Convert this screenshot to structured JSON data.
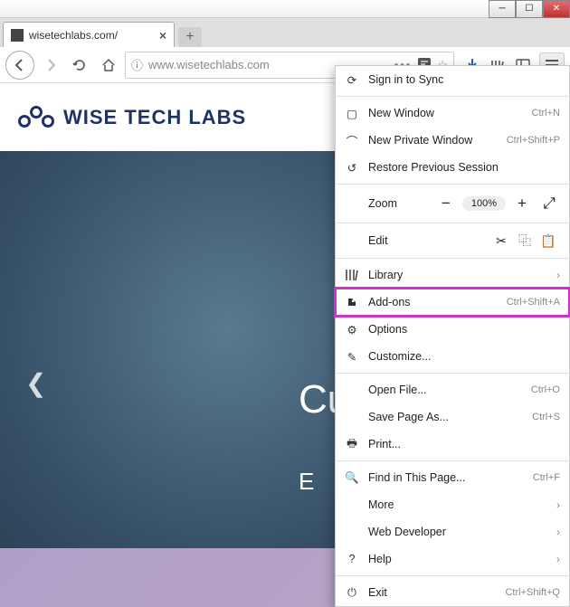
{
  "window": {
    "tab_title": "wisetechlabs.com/",
    "url_display": "www.wisetechlabs.com"
  },
  "page": {
    "logo_text": "WISE TECH LABS",
    "hero_line1": "Cu",
    "hero_line2": "E"
  },
  "menu": {
    "sign_in": "Sign in to Sync",
    "new_window": {
      "label": "New Window",
      "shortcut": "Ctrl+N"
    },
    "new_private": {
      "label": "New Private Window",
      "shortcut": "Ctrl+Shift+P"
    },
    "restore": "Restore Previous Session",
    "zoom": {
      "label": "Zoom",
      "value": "100%"
    },
    "edit": {
      "label": "Edit"
    },
    "library": "Library",
    "addons": {
      "label": "Add-ons",
      "shortcut": "Ctrl+Shift+A"
    },
    "options": "Options",
    "customize": "Customize...",
    "open_file": {
      "label": "Open File...",
      "shortcut": "Ctrl+O"
    },
    "save_as": {
      "label": "Save Page As...",
      "shortcut": "Ctrl+S"
    },
    "print": "Print...",
    "find": {
      "label": "Find in This Page...",
      "shortcut": "Ctrl+F"
    },
    "more": "More",
    "web_dev": "Web Developer",
    "help": "Help",
    "exit": {
      "label": "Exit",
      "shortcut": "Ctrl+Shift+Q"
    }
  }
}
